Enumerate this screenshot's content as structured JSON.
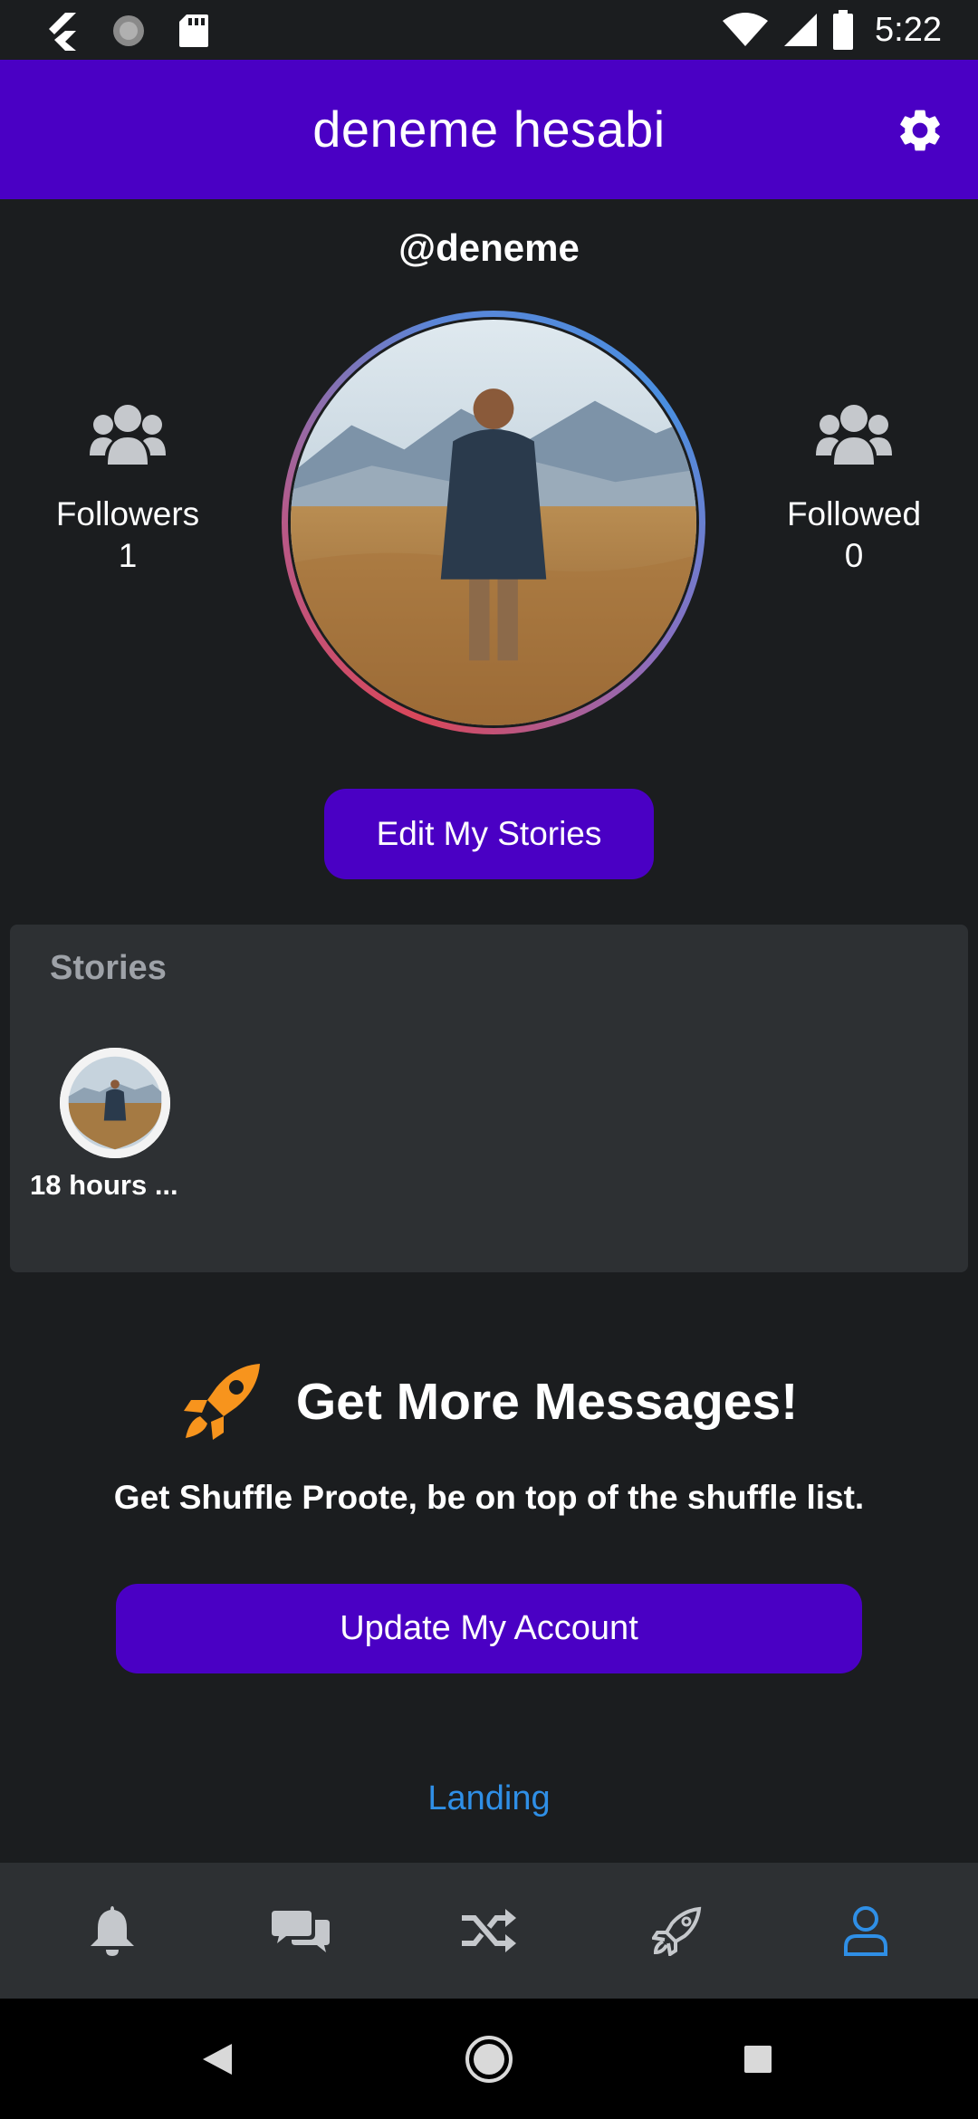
{
  "status_bar": {
    "time": "5:22",
    "icons": [
      "flutter-icon",
      "loading-icon",
      "sd-card-icon",
      "wifi-icon",
      "signal-icon",
      "battery-icon"
    ]
  },
  "app_bar": {
    "title": "deneme hesabi",
    "settings_icon": "gear-icon"
  },
  "profile": {
    "username": "@deneme",
    "followers": {
      "label": "Followers",
      "value": "1",
      "icon": "group-icon"
    },
    "followed": {
      "label": "Followed",
      "value": "0",
      "icon": "group-icon"
    },
    "ring_colors": [
      "#d9475a",
      "#4a8fe0"
    ],
    "edit_stories_label": "Edit My Stories"
  },
  "stories": {
    "title": "Stories",
    "items": [
      {
        "label": "18 hours ..."
      }
    ]
  },
  "promo": {
    "title": "Get More Messages!",
    "subtitle": "Get Shuffle Proote, be on top of the shuffle list.",
    "button_label": "Update My Account",
    "icon": "rocket-icon"
  },
  "landing_link": "Landing",
  "bottom_nav": {
    "items": [
      {
        "name": "notifications",
        "icon": "bell-icon"
      },
      {
        "name": "messages",
        "icon": "chat-bubbles-icon"
      },
      {
        "name": "shuffle",
        "icon": "shuffle-icon"
      },
      {
        "name": "boost",
        "icon": "rocket-icon"
      },
      {
        "name": "profile",
        "icon": "user-icon",
        "active": true
      }
    ]
  },
  "colors": {
    "primary": "#4a00c4",
    "background": "#1b1d1f",
    "card": "#2d3033",
    "link": "#2f8fe6",
    "rocket": "#f7941d"
  }
}
